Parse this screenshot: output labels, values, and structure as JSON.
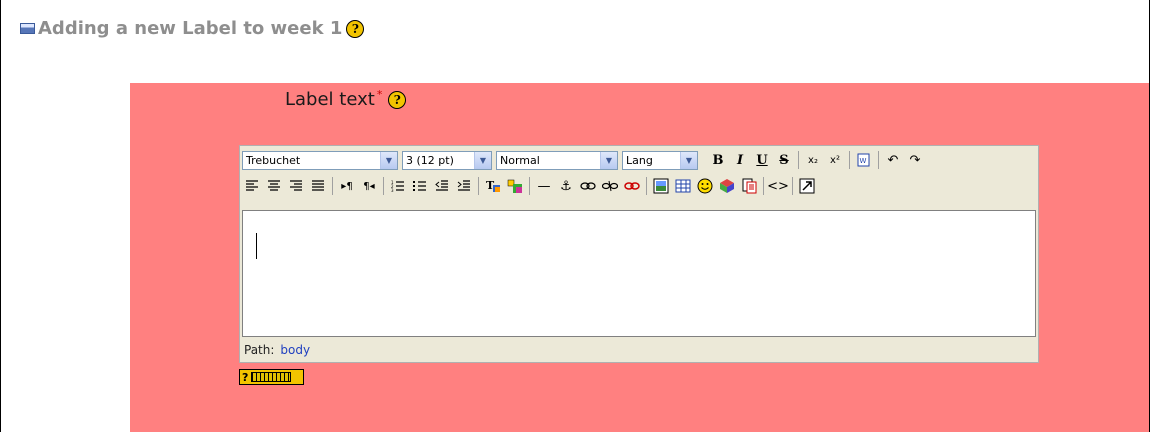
{
  "header": {
    "title": "Adding a new Label to week 1",
    "icon": "label-module-icon",
    "help_icon": "help-icon"
  },
  "form": {
    "label_text": "Label text",
    "required_mark": "*",
    "help_icon": "help-icon"
  },
  "editor": {
    "font_family": "Trebuchet",
    "font_size": "3 (12 pt)",
    "paragraph_style": "Normal",
    "language": "Lang",
    "path_label": "Path:",
    "path_value": "body",
    "toolbar1": [
      "bold-icon",
      "italic-icon",
      "underline-icon",
      "strikethrough-icon",
      "subscript-icon",
      "superscript-icon",
      "clean-word-icon",
      "undo-icon",
      "redo-icon"
    ],
    "toolbar2": [
      "align-left-icon",
      "align-center-icon",
      "align-right-icon",
      "justify-icon",
      "ltr-icon",
      "rtl-icon",
      "ordered-list-icon",
      "unordered-list-icon",
      "outdent-icon",
      "indent-icon",
      "text-color-icon",
      "background-color-icon",
      "horizontal-rule-icon",
      "anchor-icon",
      "link-icon",
      "unlink-icon",
      "nolink-icon",
      "image-icon",
      "table-icon",
      "smiley-icon",
      "special-char-icon",
      "search-replace-icon",
      "html-source-icon",
      "fullscreen-icon"
    ],
    "text_content": ""
  },
  "keyboard_help": {
    "label": "?"
  },
  "colors": {
    "panel_bg": "#ff8080",
    "heading_gray": "#8e8e8e",
    "editor_bg": "#ece9d8",
    "help_yellow": "#f2c400"
  }
}
